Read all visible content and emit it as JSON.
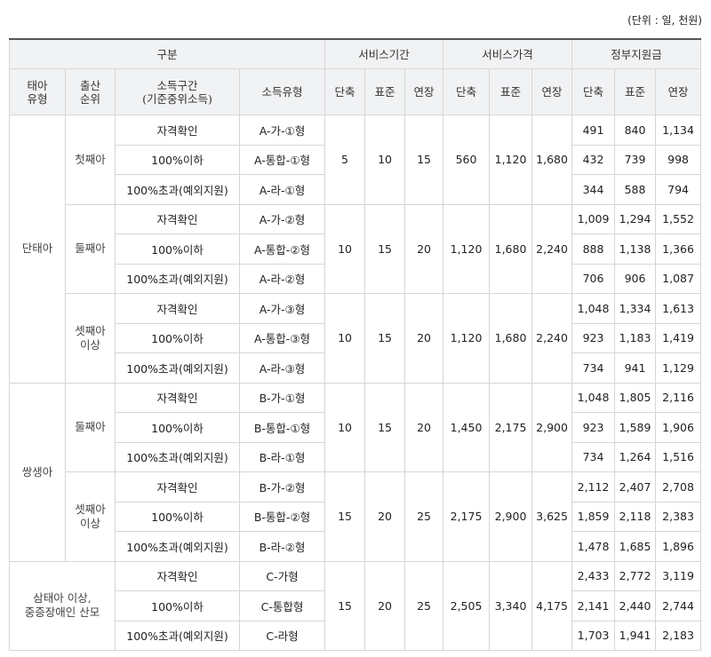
{
  "unit_label": "(단위 : 일, 천원)",
  "header": {
    "group_label": "구분",
    "service_period": "서비스기간",
    "service_price": "서비스가격",
    "subsidy": "정부지원금",
    "fetus_type": "태아\n유형",
    "birth_order": "출산\n순위",
    "income_range": "소득구간\n(기준중위소득)",
    "income_type": "소득유형",
    "short": "단축",
    "standard": "표준",
    "extended": "연장"
  },
  "groups": [
    {
      "fetus": "단태아",
      "orders": [
        {
          "order": "첫째아",
          "period": [
            "5",
            "10",
            "15"
          ],
          "price": [
            "560",
            "1,120",
            "1,680"
          ],
          "rows": [
            {
              "income": "자격확인",
              "type": "A-가-①형",
              "subsidy": [
                "491",
                "840",
                "1,134"
              ]
            },
            {
              "income": "100%이하",
              "type": "A-통합-①형",
              "subsidy": [
                "432",
                "739",
                "998"
              ]
            },
            {
              "income": "100%초과(예외지원)",
              "type": "A-라-①형",
              "subsidy": [
                "344",
                "588",
                "794"
              ]
            }
          ]
        },
        {
          "order": "둘째아",
          "period": [
            "10",
            "15",
            "20"
          ],
          "price": [
            "1,120",
            "1,680",
            "2,240"
          ],
          "rows": [
            {
              "income": "자격확인",
              "type": "A-가-②형",
              "subsidy": [
                "1,009",
                "1,294",
                "1,552"
              ]
            },
            {
              "income": "100%이하",
              "type": "A-통합-②형",
              "subsidy": [
                "888",
                "1,138",
                "1,366"
              ]
            },
            {
              "income": "100%초과(예외지원)",
              "type": "A-라-②형",
              "subsidy": [
                "706",
                "906",
                "1,087"
              ]
            }
          ]
        },
        {
          "order": "셋째아\n이상",
          "period": [
            "10",
            "15",
            "20"
          ],
          "price": [
            "1,120",
            "1,680",
            "2,240"
          ],
          "rows": [
            {
              "income": "자격확인",
              "type": "A-가-③형",
              "subsidy": [
                "1,048",
                "1,334",
                "1,613"
              ]
            },
            {
              "income": "100%이하",
              "type": "A-통합-③형",
              "subsidy": [
                "923",
                "1,183",
                "1,419"
              ]
            },
            {
              "income": "100%초과(예외지원)",
              "type": "A-라-③형",
              "subsidy": [
                "734",
                "941",
                "1,129"
              ]
            }
          ]
        }
      ]
    },
    {
      "fetus": "쌍생아",
      "orders": [
        {
          "order": "둘째아",
          "period": [
            "10",
            "15",
            "20"
          ],
          "price": [
            "1,450",
            "2,175",
            "2,900"
          ],
          "rows": [
            {
              "income": "자격확인",
              "type": "B-가-①형",
              "subsidy": [
                "1,048",
                "1,805",
                "2,116"
              ]
            },
            {
              "income": "100%이하",
              "type": "B-통합-①형",
              "subsidy": [
                "923",
                "1,589",
                "1,906"
              ]
            },
            {
              "income": "100%초과(예외지원)",
              "type": "B-라-①형",
              "subsidy": [
                "734",
                "1,264",
                "1,516"
              ]
            }
          ]
        },
        {
          "order": "셋째아\n이상",
          "period": [
            "15",
            "20",
            "25"
          ],
          "price": [
            "2,175",
            "2,900",
            "3,625"
          ],
          "rows": [
            {
              "income": "자격확인",
              "type": "B-가-②형",
              "subsidy": [
                "2,112",
                "2,407",
                "2,708"
              ]
            },
            {
              "income": "100%이하",
              "type": "B-통합-②형",
              "subsidy": [
                "1,859",
                "2,118",
                "2,383"
              ]
            },
            {
              "income": "100%초과(예외지원)",
              "type": "B-라-②형",
              "subsidy": [
                "1,478",
                "1,685",
                "1,896"
              ]
            }
          ]
        }
      ]
    },
    {
      "fetus": "삼태아 이상,\n중증장애인 산모",
      "merged": true,
      "orders": [
        {
          "order": "",
          "period": [
            "15",
            "20",
            "25"
          ],
          "price": [
            "2,505",
            "3,340",
            "4,175"
          ],
          "rows": [
            {
              "income": "자격확인",
              "type": "C-가형",
              "subsidy": [
                "2,433",
                "2,772",
                "3,119"
              ]
            },
            {
              "income": "100%이하",
              "type": "C-통합형",
              "subsidy": [
                "2,141",
                "2,440",
                "2,744"
              ]
            },
            {
              "income": "100%초과(예외지원)",
              "type": "C-라형",
              "subsidy": [
                "1,703",
                "1,941",
                "2,183"
              ]
            }
          ]
        }
      ]
    }
  ]
}
